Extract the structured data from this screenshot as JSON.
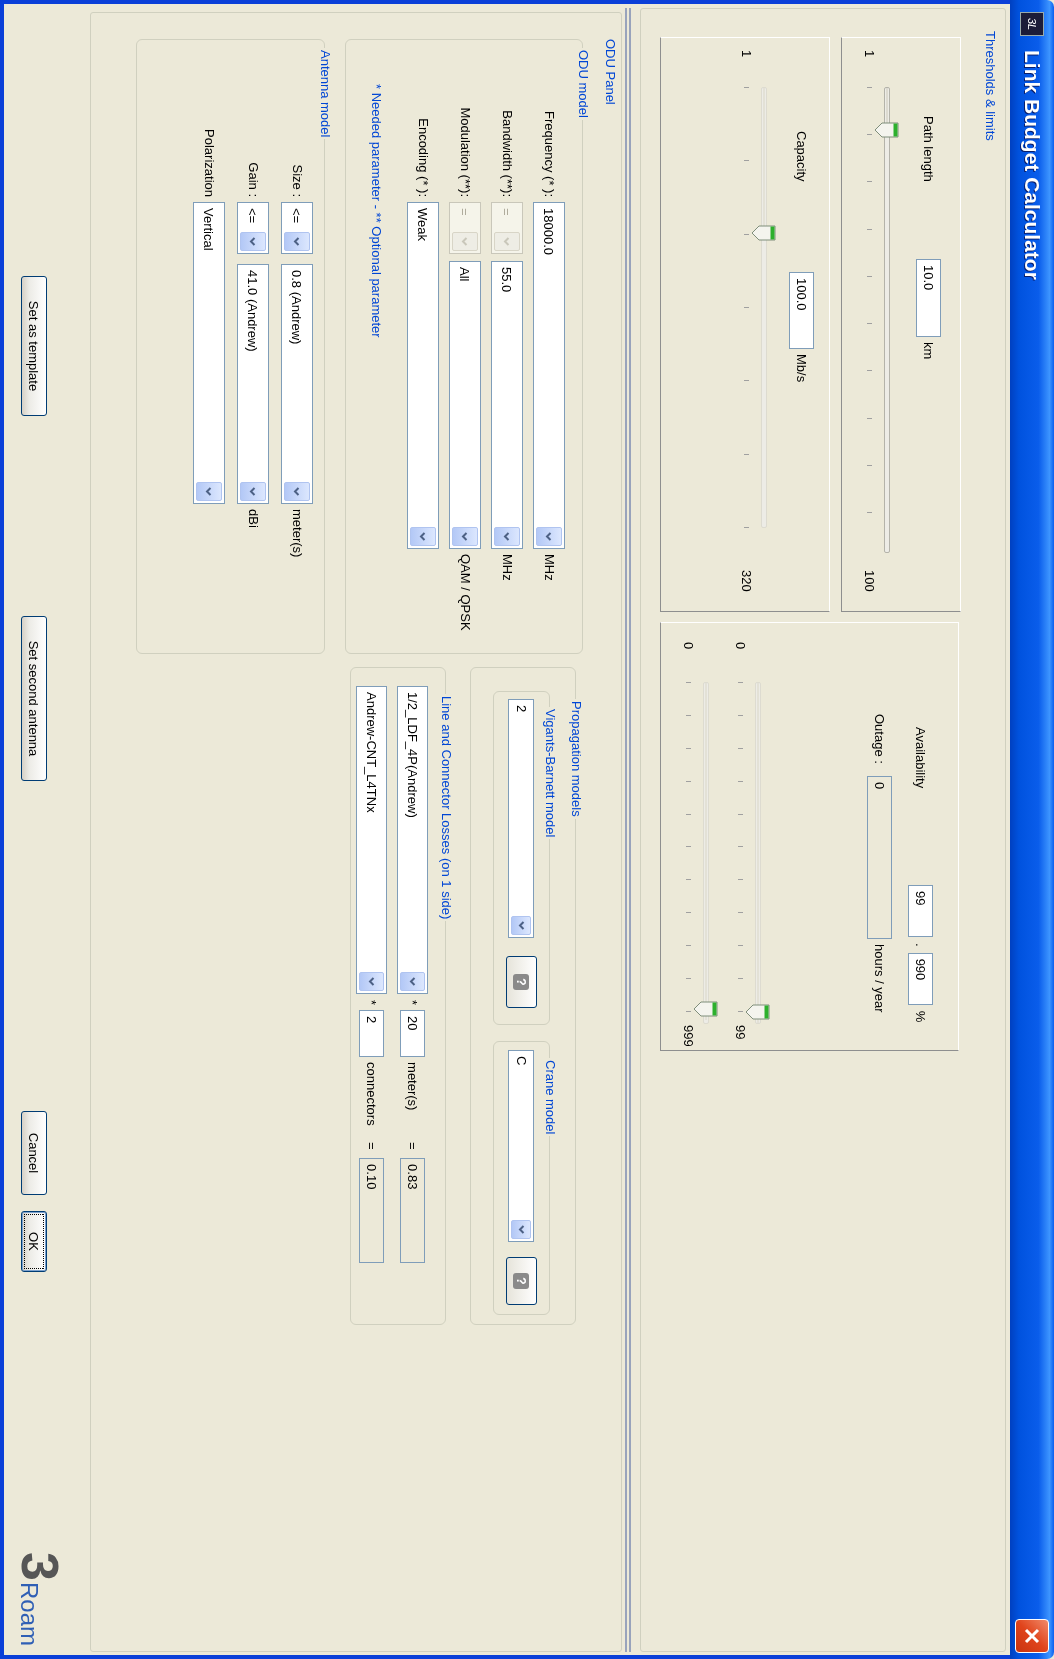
{
  "window": {
    "icon_label": "3L",
    "title": "Link Budget Calculator"
  },
  "thresholds": {
    "title": "Thresholds & limits",
    "path_length": {
      "label": "Path length",
      "value": "10.0",
      "unit": "km",
      "slider": {
        "min": "1",
        "max": "100",
        "level": 0.1
      }
    },
    "capacity": {
      "label": "Capacity",
      "value": "100.0",
      "unit": "Mb/s",
      "slider": {
        "min": "1",
        "max": "320",
        "level": 0.33
      }
    },
    "availability": {
      "label": "Availability",
      "integer": "99",
      "separator": ".",
      "decimal": "990",
      "unit": "%",
      "outage_label": "Outage :",
      "outage_value": "0",
      "outage_unit": "hours / year",
      "sliders": [
        {
          "min": "0",
          "max": "99",
          "level": 1
        },
        {
          "min": "0",
          "max": "999",
          "level": 0.99
        }
      ]
    }
  },
  "odu_panel": {
    "title": "ODU Panel",
    "odu_model": {
      "title": "ODU model",
      "rows": [
        {
          "label": "Frequency (* ):",
          "value": "18000.0",
          "unit": "MHz"
        },
        {
          "label": "Bandwidth (**):",
          "operator": {
            "value": "=",
            "disabled": true
          },
          "value": "55.0",
          "unit": "MHz"
        },
        {
          "label": "Modulation (**):",
          "operator": {
            "value": "=",
            "disabled": true
          },
          "value": "All",
          "unit": "QAM / QPSK"
        },
        {
          "label": "Encoding (* ):",
          "value": "Weak"
        }
      ],
      "note": "* Needed parameter - ** Optional parameter"
    },
    "antenna_model": {
      "title": "Antenna model",
      "rows": [
        {
          "label": "Size :",
          "operator": {
            "value": "<=",
            "disabled": false
          },
          "value": "0.8 (Andrew)",
          "unit": "meter(s)"
        },
        {
          "label": "Gain :",
          "operator": {
            "value": "<=",
            "disabled": false
          },
          "value": "41.0 (Andrew)",
          "unit": "dBi"
        },
        {
          "label": "Polarization",
          "value": "Vertical"
        }
      ]
    },
    "propagation_models": {
      "title": "Propagation models",
      "models": [
        {
          "title": "Vigants-Barnett model",
          "value": "2",
          "help": "?"
        },
        {
          "title": "Crane model",
          "value": "C",
          "help": "?"
        }
      ]
    },
    "line_losses": {
      "title": "Line and Connector Losses (on 1 side)",
      "rows": [
        {
          "item": "1/2_LDF_4P(Andrew)",
          "times": "*",
          "count": "20",
          "unit": "meter(s)",
          "equals": "=",
          "result": "0.83"
        },
        {
          "item": "Andrew-CNT_L4TNx",
          "times": "*",
          "count": "2",
          "unit": "connectors",
          "equals": "=",
          "result": "0.10"
        }
      ]
    }
  },
  "buttons": [
    {
      "label": "Set as template",
      "focused": false
    },
    {
      "label": "Set second antenna",
      "focused": false
    },
    {
      "label": "Cancel",
      "focused": false
    },
    {
      "label": "OK",
      "focused": true
    }
  ],
  "logo": {
    "mark": "3",
    "word": "Roam"
  }
}
